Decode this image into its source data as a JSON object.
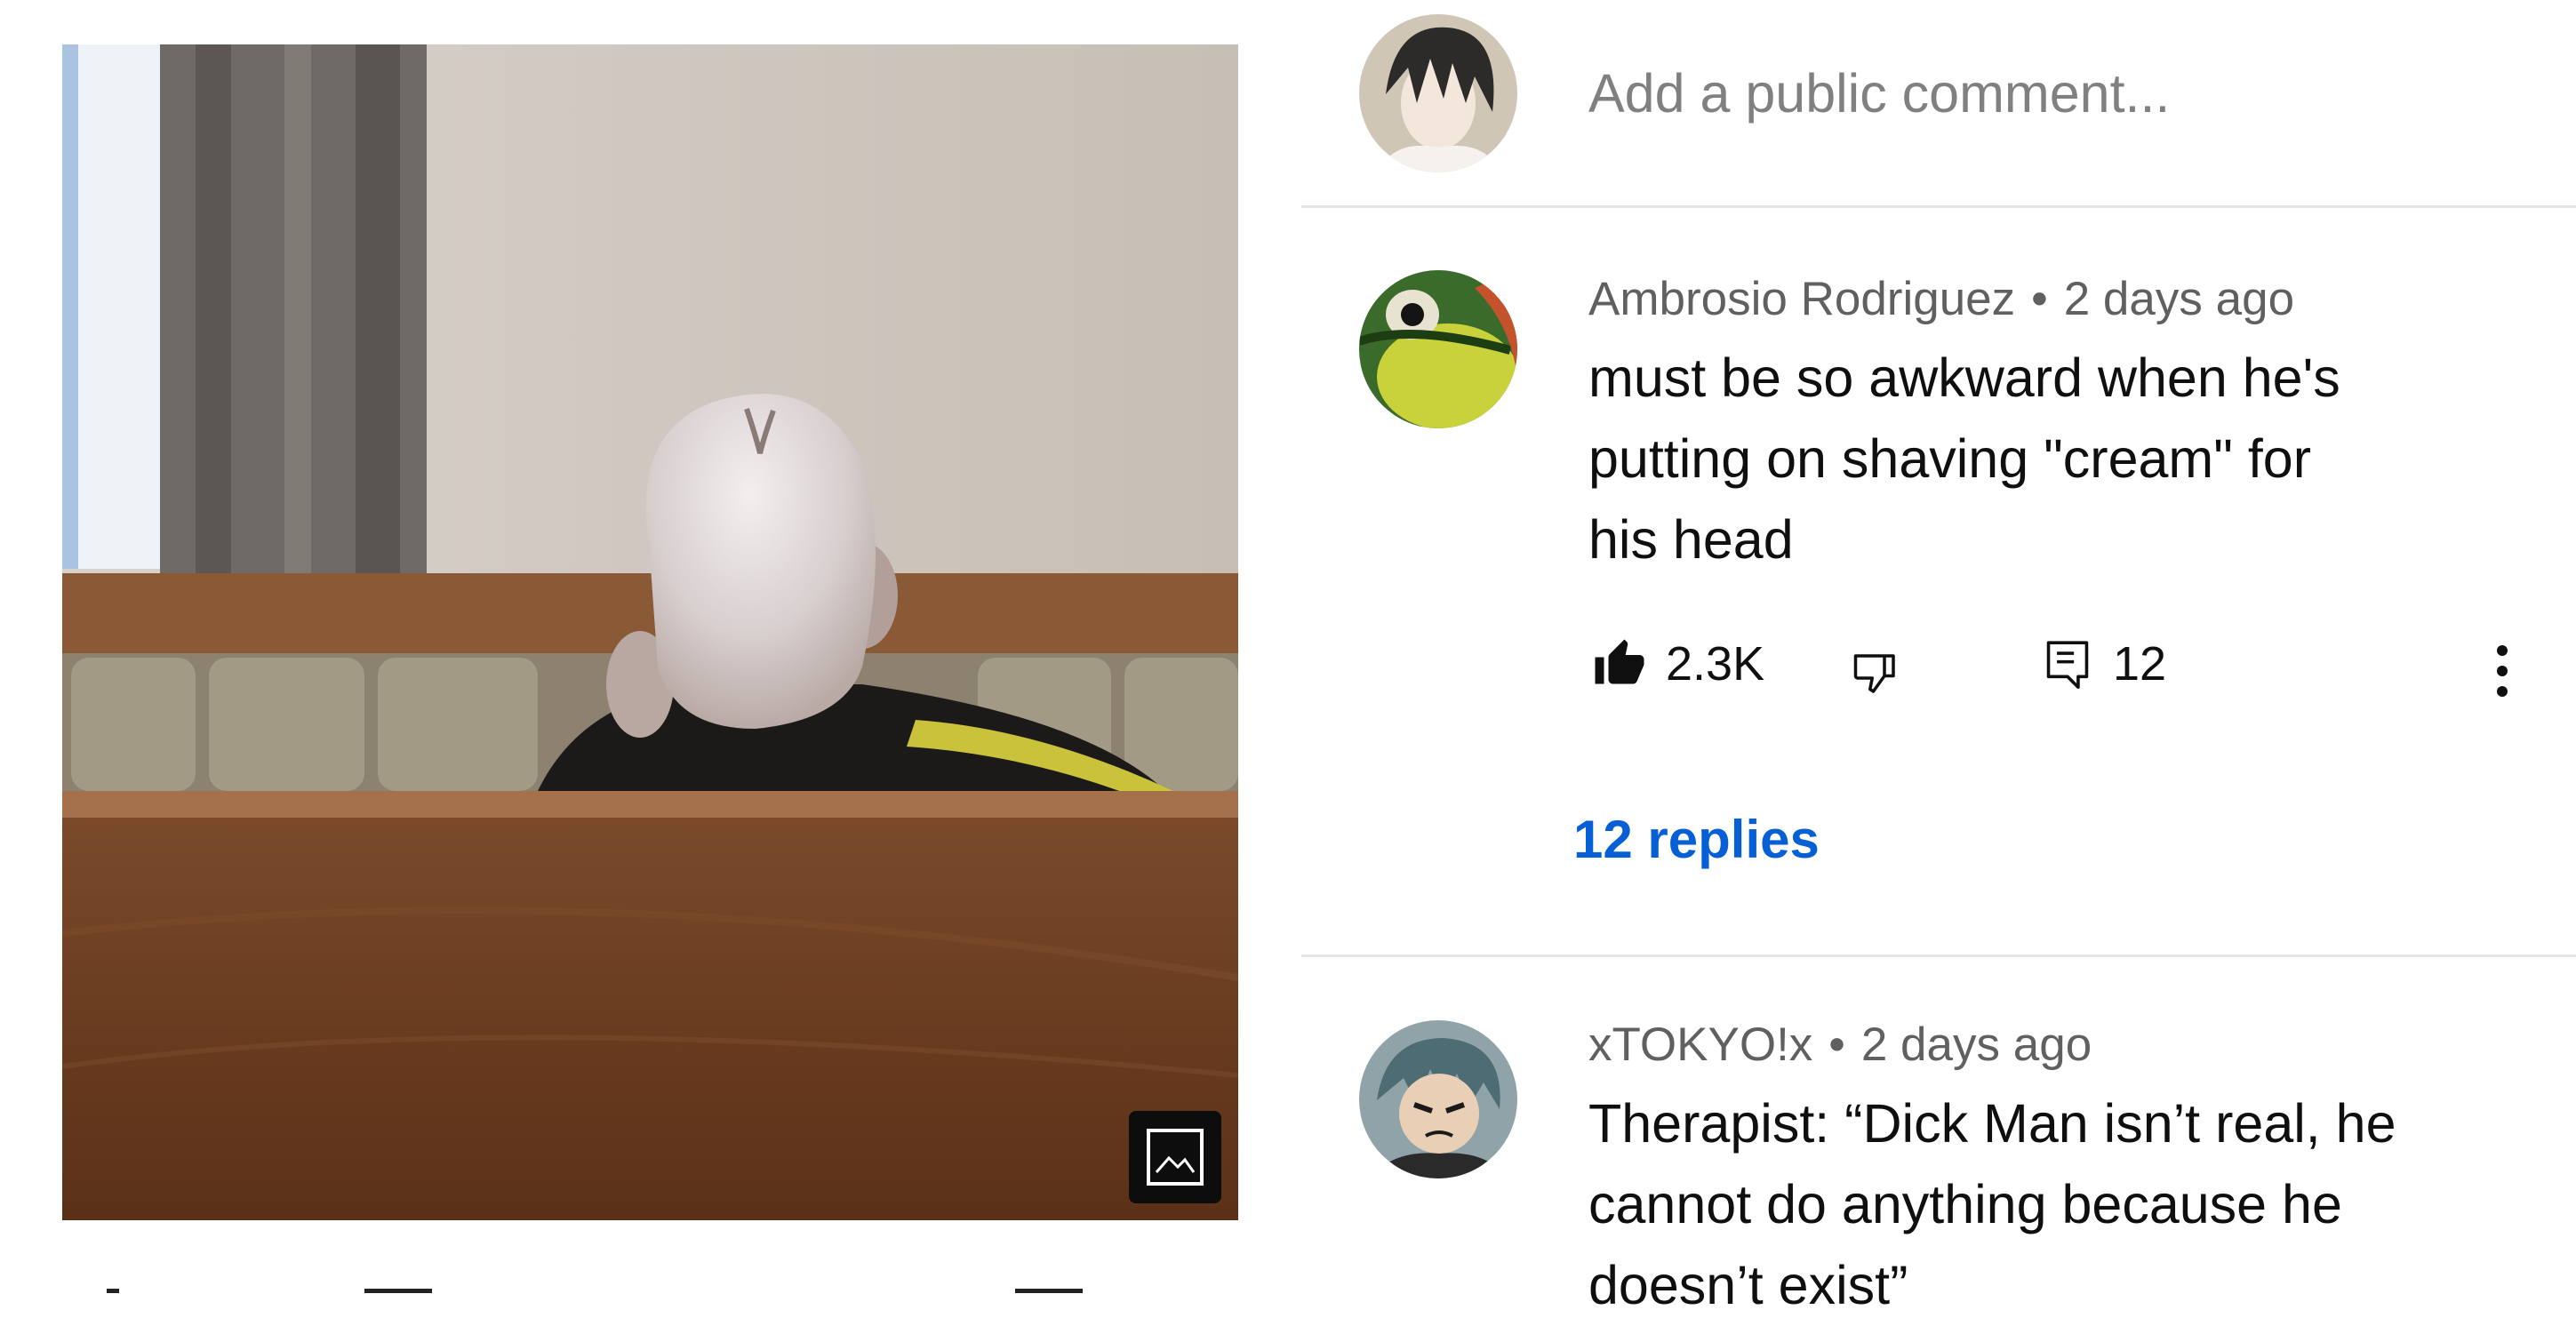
{
  "composer": {
    "placeholder": "Add a public comment..."
  },
  "comments": [
    {
      "author": "Ambrosio Rodriguez",
      "separator": "•",
      "time": "2 days ago",
      "text_lines": [
        "must be so awkward when he's",
        "putting on shaving \"cream\" for",
        "his head"
      ],
      "likes": "2.3K",
      "reply_count": "12",
      "replies_label": "12 replies"
    },
    {
      "author": "xTOKYO!x",
      "separator": "•",
      "time": "2 days ago",
      "text_lines": [
        "Therapist: “Dick Man isn’t real, he",
        "cannot do anything because he",
        "doesn’t exist”"
      ]
    }
  ],
  "icons": {
    "like": "thumbs-up-filled-icon",
    "dislike": "thumbs-down-outline-icon",
    "reply": "comment-icon",
    "more": "more-vertical-icon",
    "image": "image-icon"
  },
  "colors": {
    "link": "#065fd4",
    "secondary_text": "#606060",
    "placeholder": "#808080",
    "divider": "#e5e5e5"
  }
}
